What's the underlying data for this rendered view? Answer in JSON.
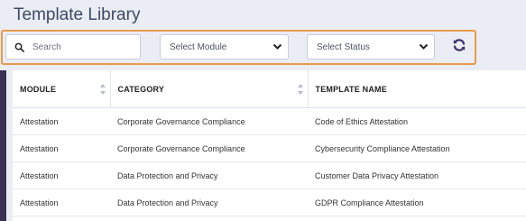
{
  "page": {
    "title": "Template Library"
  },
  "filters": {
    "search_placeholder": "Search",
    "module_select": "Select Module",
    "status_select": "Select Status",
    "refresh_icon": "refresh-icon"
  },
  "table": {
    "columns": [
      "MODULE",
      "CATEGORY",
      "TEMPLATE NAME"
    ],
    "rows": [
      [
        "Attestation",
        "Corporate Governance Compliance",
        "Code of Ethics Attestation"
      ],
      [
        "Attestation",
        "Corporate Governance Compliance",
        "Cybersecurity Compliance Attestation"
      ],
      [
        "Attestation",
        "Data Protection and Privacy",
        "Customer Data Privacy Attestation"
      ],
      [
        "Attestation",
        "Data Protection and Privacy",
        "GDPR Compliance Attestation"
      ]
    ]
  },
  "colors": {
    "accent_border": "#e89a4c",
    "refresh_icon": "#3a2f6b",
    "background": "#ebedf4"
  }
}
